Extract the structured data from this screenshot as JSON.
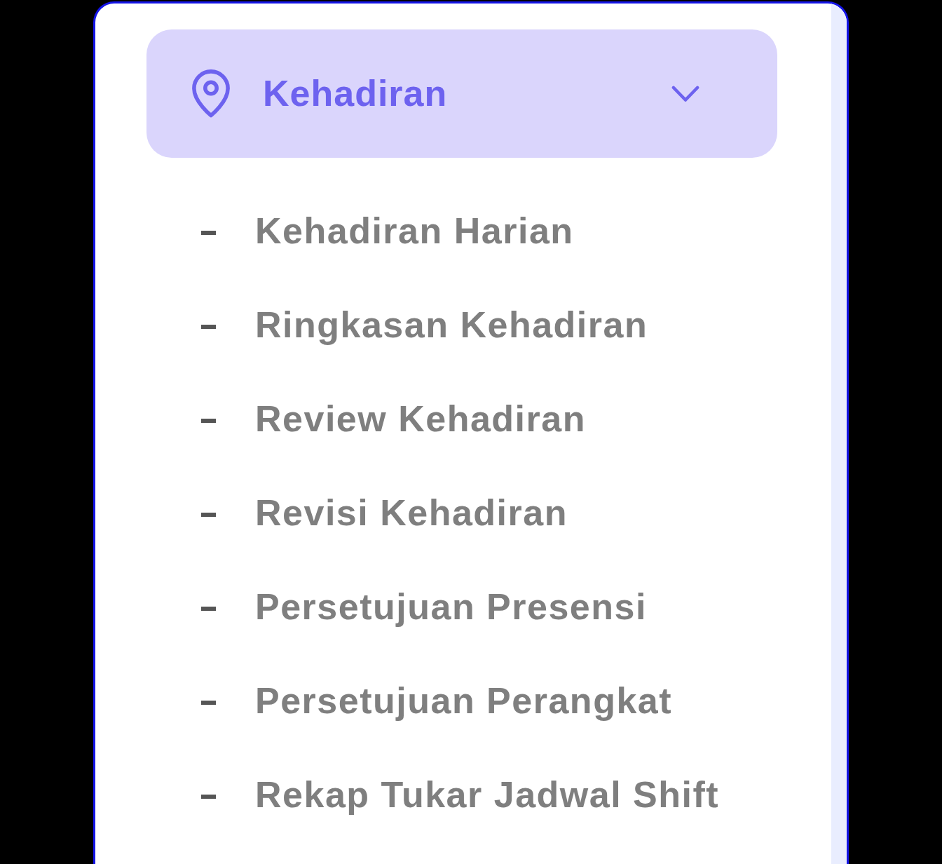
{
  "menu": {
    "label": "Kehadiran",
    "selected": true,
    "expanded": true,
    "items": [
      {
        "label": "Kehadiran Harian"
      },
      {
        "label": "Ringkasan Kehadiran"
      },
      {
        "label": "Review Kehadiran"
      },
      {
        "label": "Revisi Kehadiran"
      },
      {
        "label": "Persetujuan Presensi"
      },
      {
        "label": "Persetujuan Perangkat"
      },
      {
        "label": "Rekap Tukar Jadwal Shift"
      }
    ]
  }
}
